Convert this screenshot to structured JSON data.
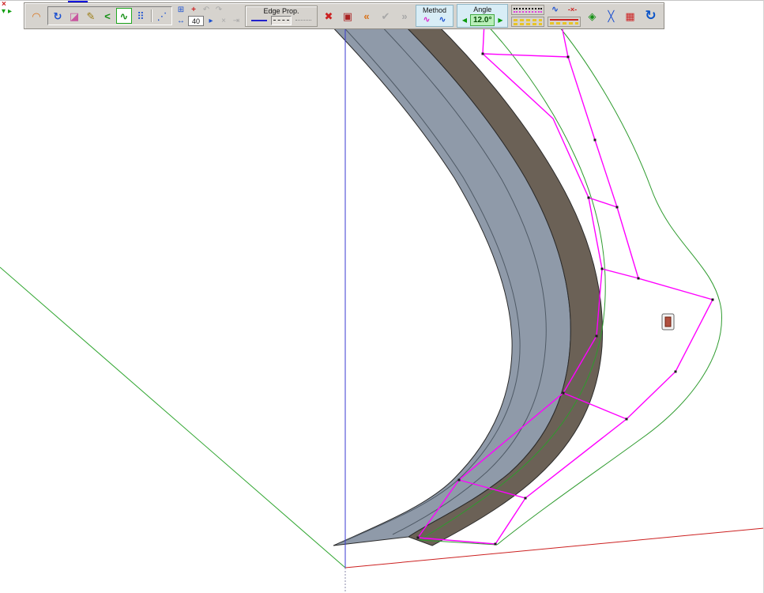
{
  "mini_toolbar": {
    "close": "×",
    "collapse": "▾",
    "expand": "▸"
  },
  "toolbar": {
    "edge_prop_label": "Edge Prop.",
    "method_label": "Method",
    "angle_label": "Angle",
    "angle_value": "12.0°",
    "angle_prev": "◀",
    "angle_next": "▶",
    "offset_value": "40",
    "icons": {
      "curve_tool": "◠",
      "rotate": "↻",
      "eraser": "◪",
      "pencil": "✎",
      "angle_less": "<",
      "polyline": "∿",
      "dot_grid": "⠿",
      "diag_dots": "⋰",
      "frame": "⊞",
      "move_cross": "+",
      "undo_small": "↶",
      "redo_small": "↷",
      "width_arrow": "↔",
      "play_small": "▸",
      "close_small": "×",
      "tab_small": "⇥",
      "delete": "✖",
      "component_box": "▣",
      "undo_all": "«",
      "confirm": "✔",
      "redo_all": "»",
      "method_a": "∿",
      "method_b": "∿",
      "spline_nodes": "∿",
      "remove_node": "-×-",
      "paint": "◈",
      "erase_guides": "╳",
      "red_grid": "▦",
      "main_tool": "↻"
    }
  },
  "canvas": {
    "axis_blue": "#3a3ad0",
    "axis_green": "#2fa52f",
    "axis_red": "#cc2020",
    "road_light": "#8f9aa9",
    "road_dark": "#6b6156",
    "road_outline": "#2b2b2b",
    "lane_line": "#4f5a66",
    "spline_green": "#2e9b2e",
    "offset_magenta": "#ff00ff",
    "vertex_color": "#1a1a1a"
  }
}
